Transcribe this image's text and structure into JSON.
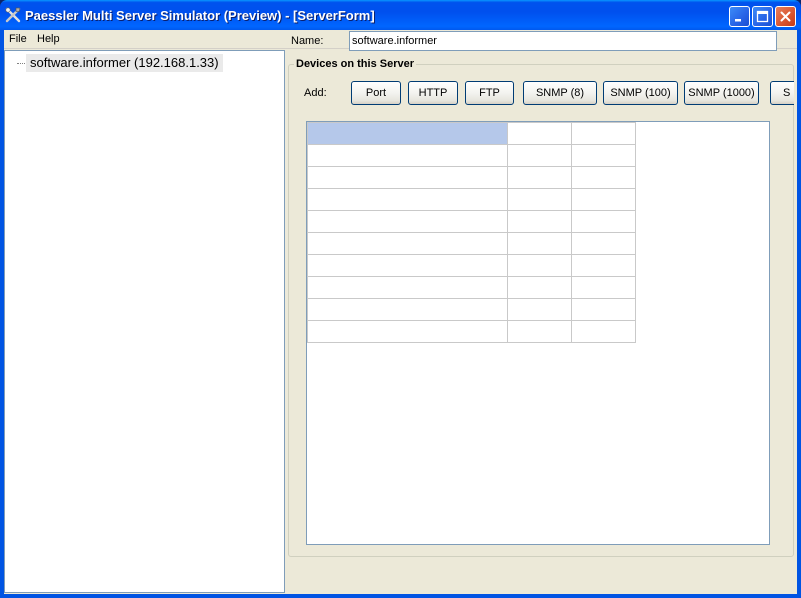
{
  "window": {
    "title": "Paessler Multi Server Simulator (Preview) - [ServerForm]",
    "icon": "tools-icon",
    "controls": [
      "minimize-icon",
      "maximize-icon",
      "close-icon"
    ]
  },
  "menu": {
    "items": [
      {
        "label": "File"
      },
      {
        "label": "Help"
      }
    ]
  },
  "tree": {
    "nodes": [
      {
        "label": "software.informer (192.168.1.33)",
        "selected": true
      }
    ]
  },
  "form": {
    "name_label": "Name:",
    "name_value": "software.informer",
    "group_title": "Devices on this Server",
    "add_label": "Add:",
    "buttons": [
      {
        "label": "Port"
      },
      {
        "label": "HTTP"
      },
      {
        "label": "FTP"
      },
      {
        "label": "SNMP (8)"
      },
      {
        "label": "SNMP (100)"
      },
      {
        "label": "SNMP (1000)"
      },
      {
        "label": "S"
      }
    ]
  },
  "grid": {
    "rows": 10,
    "columns": 3,
    "selected_row": 0,
    "cells": [
      [
        "",
        "",
        ""
      ],
      [
        "",
        "",
        ""
      ],
      [
        "",
        "",
        ""
      ],
      [
        "",
        "",
        ""
      ],
      [
        "",
        "",
        ""
      ],
      [
        "",
        "",
        ""
      ],
      [
        "",
        "",
        ""
      ],
      [
        "",
        "",
        ""
      ],
      [
        "",
        "",
        ""
      ],
      [
        "",
        "",
        ""
      ]
    ]
  },
  "colors": {
    "title_bar": "#0054e3",
    "client_bg": "#ece9d8",
    "selection": "#b5c8ea",
    "border": "#7f9db9"
  }
}
